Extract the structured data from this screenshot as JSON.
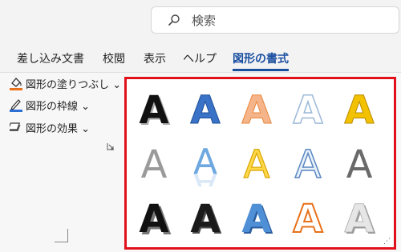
{
  "search": {
    "placeholder": "検索",
    "icon": "search-icon"
  },
  "tabs": [
    {
      "label": "差し込み文書",
      "active": false
    },
    {
      "label": "校閲",
      "active": false
    },
    {
      "label": "表示",
      "active": false
    },
    {
      "label": "ヘルプ",
      "active": false
    },
    {
      "label": "図形の書式",
      "active": true
    }
  ],
  "commands": {
    "fill": {
      "label": "図形の塗りつぶし",
      "icon": "paint-bucket-icon",
      "accent": "#e8711a"
    },
    "outline": {
      "label": "図形の枠線",
      "icon": "pen-outline-icon",
      "accent": "#2a6fd6"
    },
    "effects": {
      "label": "図形の効果",
      "icon": "shape-effects-icon"
    },
    "dropdown_glyph": "⌄"
  },
  "gallery": {
    "highlight_color": "#e0111a",
    "letter": "A",
    "styles": [
      "black-shadow",
      "blue-bevel",
      "orange-gradient",
      "outline-light-blue",
      "gold-bevel",
      "gray-gradient",
      "blue-reflection",
      "gold-outline",
      "light-blue-outline",
      "dark-gray-gradient",
      "black-3d-shadow",
      "black-3d",
      "blue-3d",
      "orange-outline",
      "silver-shadow"
    ]
  },
  "fragments": {
    "left": ".",
    "right": "⌄"
  },
  "resize_glyph": "⋰"
}
